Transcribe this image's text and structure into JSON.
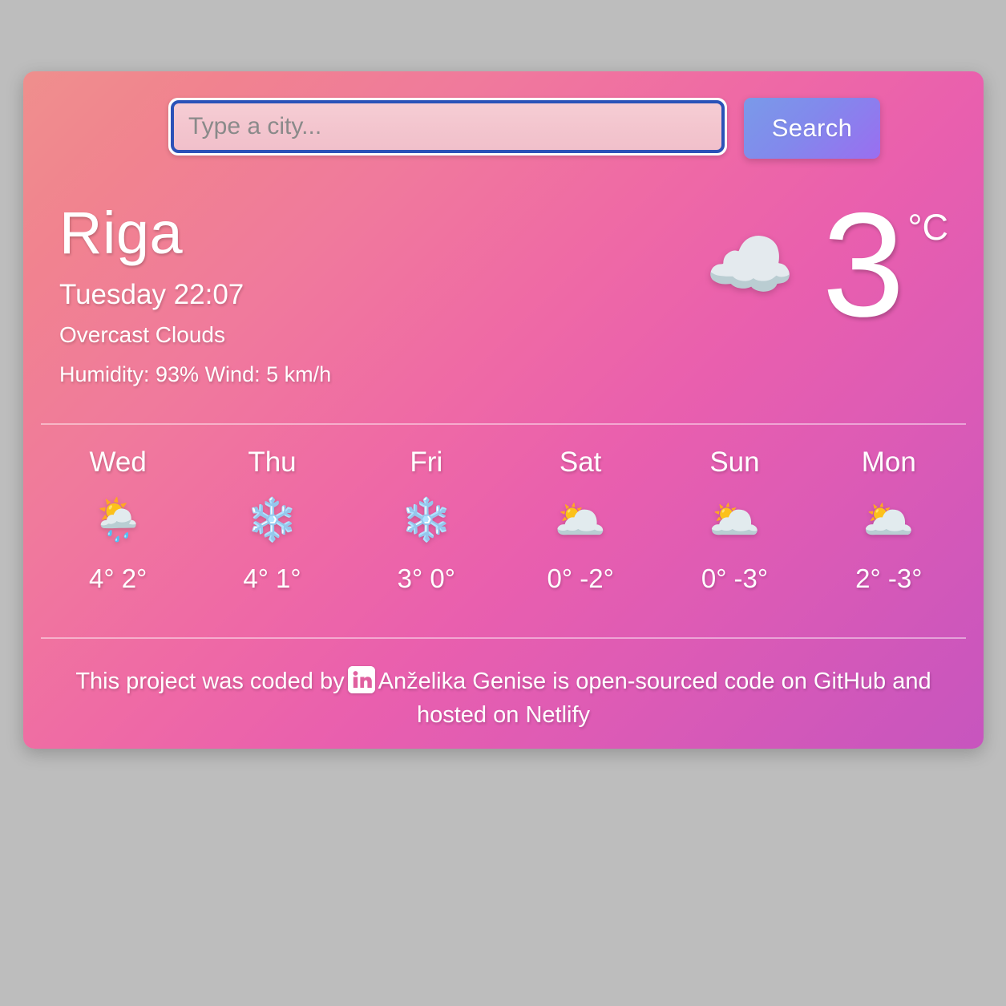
{
  "page": {
    "background_color": "#bdbdbd"
  },
  "card": {
    "gradient_from": "#ef8f8d",
    "gradient_to": "#c755be"
  },
  "search": {
    "placeholder": "Type a city...",
    "value": "",
    "button_label": "Search",
    "button_gradient_from": "#7a9ae9",
    "button_gradient_to": "#9a6ef0",
    "input_border_color": "#2b52b8"
  },
  "current": {
    "city": "Riga",
    "date_time": "Tuesday 22:07",
    "description": "Overcast Clouds",
    "metrics": "Humidity: 93% Wind: 5 km/h",
    "humidity": "93%",
    "wind": "5 km/h",
    "icon": "overcast-clouds-icon",
    "icon_glyph": "☁️",
    "temperature": "3",
    "unit": "°C"
  },
  "forecast": [
    {
      "day": "Wed",
      "icon_name": "sun-behind-rain-cloud-icon",
      "icon_glyph": "🌦️",
      "temps": "4° 2°",
      "high": "4°",
      "low": "2°"
    },
    {
      "day": "Thu",
      "icon_name": "snowflake-icon",
      "icon_glyph": "❄️",
      "temps": "4° 1°",
      "high": "4°",
      "low": "1°"
    },
    {
      "day": "Fri",
      "icon_name": "snowflake-icon",
      "icon_glyph": "❄️",
      "temps": "3° 0°",
      "high": "3°",
      "low": "0°"
    },
    {
      "day": "Sat",
      "icon_name": "sun-behind-cloud-icon",
      "icon_glyph": "🌥️",
      "temps": "0° -2°",
      "high": "0°",
      "low": "-2°"
    },
    {
      "day": "Sun",
      "icon_name": "sun-behind-cloud-icon",
      "icon_glyph": "🌥️",
      "temps": "0° -3°",
      "high": "0°",
      "low": "-3°"
    },
    {
      "day": "Mon",
      "icon_name": "sun-behind-cloud-icon",
      "icon_glyph": "🌥️",
      "temps": "2° -3°",
      "high": "2°",
      "low": "-3°"
    }
  ],
  "footer": {
    "text_before_icon": "This project was coded by",
    "author": "Anželika Genise",
    "text_middle": "is open-sourced code on",
    "github_label": "GitHub",
    "text_and": "and hosted on",
    "netlify_label": "Netlify"
  }
}
